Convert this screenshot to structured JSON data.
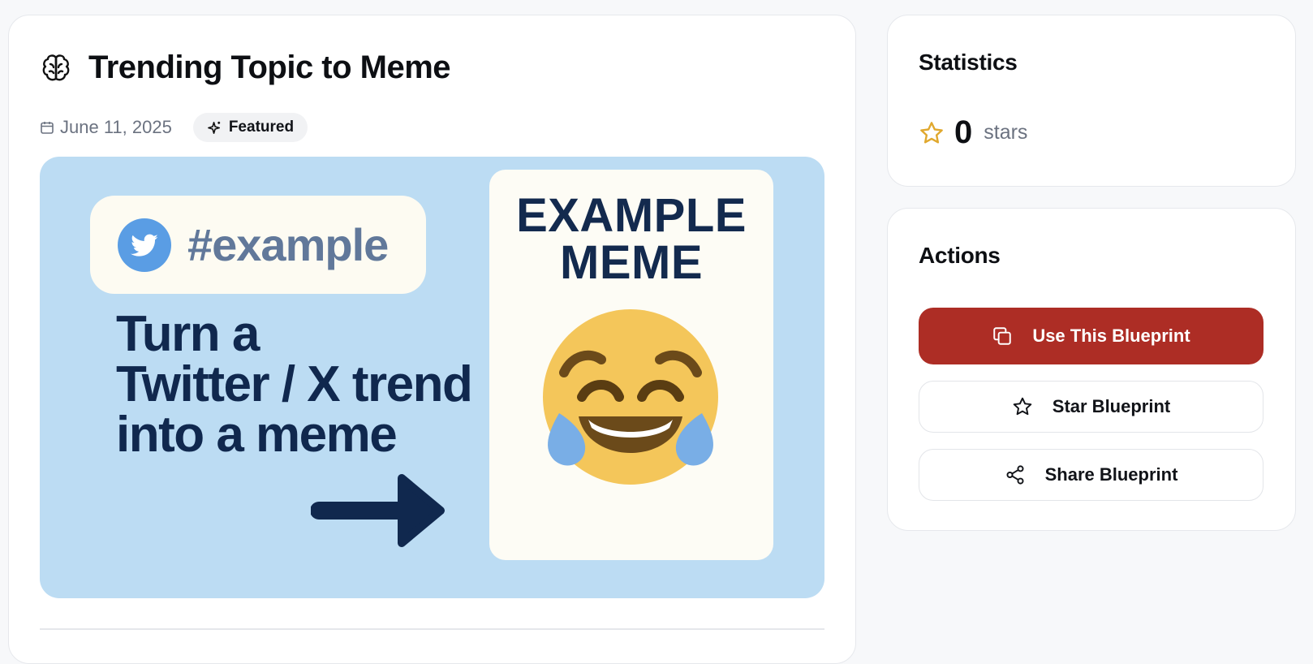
{
  "header": {
    "title": "Trending Topic to Meme",
    "title_icon": "brain-icon",
    "date": "June 11, 2025",
    "date_icon": "calendar-icon",
    "badge": "Featured",
    "badge_icon": "sparkle-icon"
  },
  "hero": {
    "hashtag": "#example",
    "headline_lines": [
      "Turn a",
      "Twitter / X trend",
      "into a meme"
    ],
    "meme_title_lines": [
      "EXAMPLE",
      "MEME"
    ],
    "meme_emoji": "face-with-tears-of-joy",
    "icons": [
      "twitter-bird-icon",
      "arrow-right-icon"
    ]
  },
  "statistics": {
    "heading": "Statistics",
    "star_count": "0",
    "star_label": "stars",
    "icon": "star-outline-icon"
  },
  "actions": {
    "heading": "Actions",
    "use_label": "Use This Blueprint",
    "use_icon": "copy-icon",
    "star_label": "Star Blueprint",
    "star_icon": "star-icon",
    "share_label": "Share Blueprint",
    "share_icon": "share-icon"
  },
  "colors": {
    "primary": "#ad2d25",
    "hero_background": "#bcdcf3",
    "navy_text": "#10284e",
    "star_gold": "#e0a82e"
  }
}
